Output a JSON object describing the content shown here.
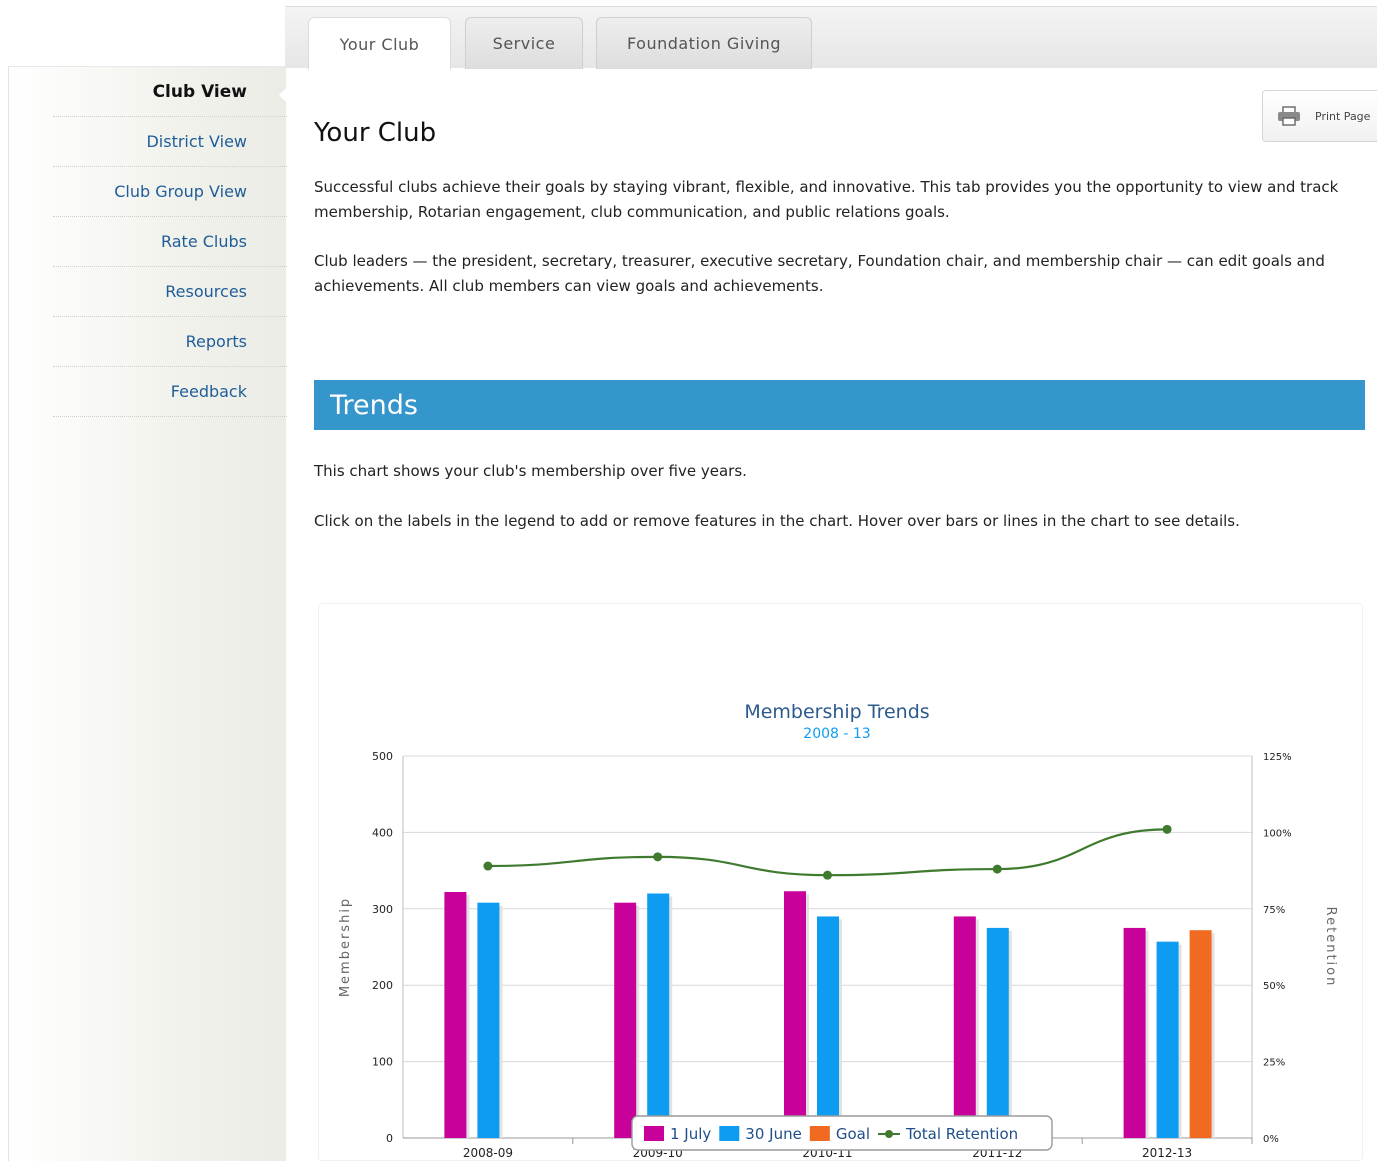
{
  "tabs": [
    {
      "label": "Your Club",
      "active": true
    },
    {
      "label": "Service",
      "active": false
    },
    {
      "label": "Foundation Giving",
      "active": false
    }
  ],
  "sidebar": {
    "items": [
      {
        "label": "Club View",
        "active": true
      },
      {
        "label": "District View",
        "active": false
      },
      {
        "label": "Club Group View",
        "active": false
      },
      {
        "label": "Rate Clubs",
        "active": false
      },
      {
        "label": "Resources",
        "active": false
      },
      {
        "label": "Reports",
        "active": false
      },
      {
        "label": "Feedback",
        "active": false
      }
    ]
  },
  "main": {
    "title": "Your Club",
    "print_label": "Print Page",
    "intro_1": "Successful clubs achieve their goals by staying vibrant, flexible, and innovative. This tab provides you the opportunity to view and track membership, Rotarian engagement, club communication, and public relations goals.",
    "intro_2": "Club leaders — the president, secretary, treasurer, executive secretary, Foundation chair, and membership chair — can edit goals and achievements. All club members can view goals and achievements.",
    "section_title": "Trends",
    "trends_1": "This chart shows your club's membership over five years.",
    "trends_2": "Click on the labels in the legend to add or remove features in the chart. Hover over bars or lines in the chart to see details."
  },
  "colors": {
    "accent": "#3596cb",
    "link": "#1f5d99",
    "july": "#c8019a",
    "june": "#0e9cf3",
    "goal": "#f06a22",
    "retention": "#3f7a2f",
    "chart_title": "#2c5a8c"
  },
  "chart_data": {
    "type": "bar",
    "title": "Membership Trends",
    "subtitle": "2008 - 13",
    "ylabel": "Membership",
    "y2label": "Retention",
    "ylim": [
      0,
      500
    ],
    "y2lim": [
      0,
      125
    ],
    "yticks": [
      "0",
      "100",
      "200",
      "300",
      "400",
      "500"
    ],
    "y2ticks": [
      "0%",
      "25%",
      "50%",
      "75%",
      "100%",
      "125%"
    ],
    "categories": [
      "2008-09",
      "2009-10",
      "2010-11",
      "2011-12",
      "2012-13"
    ],
    "series": [
      {
        "name": "1 July",
        "kind": "bar",
        "color": "#c8019a",
        "values": [
          322,
          308,
          323,
          290,
          275
        ]
      },
      {
        "name": "30 June",
        "kind": "bar",
        "color": "#0e9cf3",
        "values": [
          308,
          320,
          290,
          275,
          257
        ]
      },
      {
        "name": "Goal",
        "kind": "bar",
        "color": "#f06a22",
        "values": [
          null,
          null,
          null,
          null,
          272
        ]
      },
      {
        "name": "Total Retention",
        "kind": "line",
        "color": "#3f7a2f",
        "axis": "right",
        "values": [
          89,
          92,
          86,
          88,
          101
        ]
      }
    ],
    "grid": true,
    "legend_position": "bottom-center"
  }
}
